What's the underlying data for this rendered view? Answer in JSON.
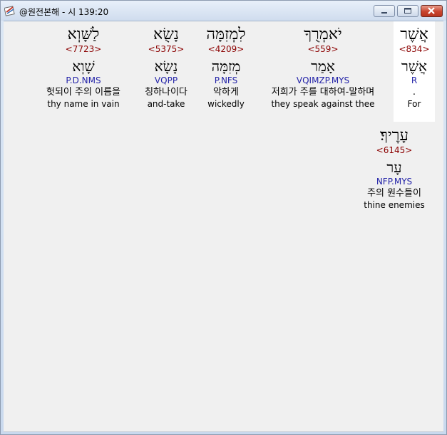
{
  "window": {
    "title": "@원전본해 - 시 139:20",
    "icons": {
      "app": "bible-app-icon",
      "minimize": "minimize-icon",
      "maximize": "maximize-icon",
      "close": "close-icon"
    }
  },
  "words": [
    {
      "hebrew": "אֲשֶׁר",
      "strong": "<834>",
      "lemma": "אֲשֶׁר",
      "morph": "R",
      "korean": ".",
      "english": "For",
      "highlight": true
    },
    {
      "hebrew": "יֹאמְרֻךָ",
      "strong": "<559>",
      "lemma": "אָמַר",
      "morph": "VQIMZP.MYS",
      "korean": "저희가 주를 대하여-말하며",
      "english": "they speak against thee",
      "highlight": false
    },
    {
      "hebrew": "לִמְזִמָּה",
      "strong": "<4209>",
      "lemma": "מְזִמָּה",
      "morph": "P.NFS",
      "korean": "악하게",
      "english": "wickedly",
      "highlight": false
    },
    {
      "hebrew": "נָשֻׂא",
      "strong": "<5375>",
      "lemma": "נָשָׂא",
      "morph": "VQPP",
      "korean": "칭하나이다",
      "english": "and-take",
      "highlight": false
    },
    {
      "hebrew": "לַשָּׁוְא",
      "strong": "<7723>",
      "lemma": "שָׁוְא",
      "morph": "P.D.NMS",
      "korean": "헛되이 주의 이름을",
      "english": "thy name in vain",
      "highlight": false
    },
    {
      "hebrew": "עָרֶיךָ׃",
      "strong": "<6145>",
      "lemma": "עָר",
      "morph": "NFP.MYS",
      "korean": "주의 원수들이",
      "english": "thine enemies",
      "highlight": false
    }
  ]
}
